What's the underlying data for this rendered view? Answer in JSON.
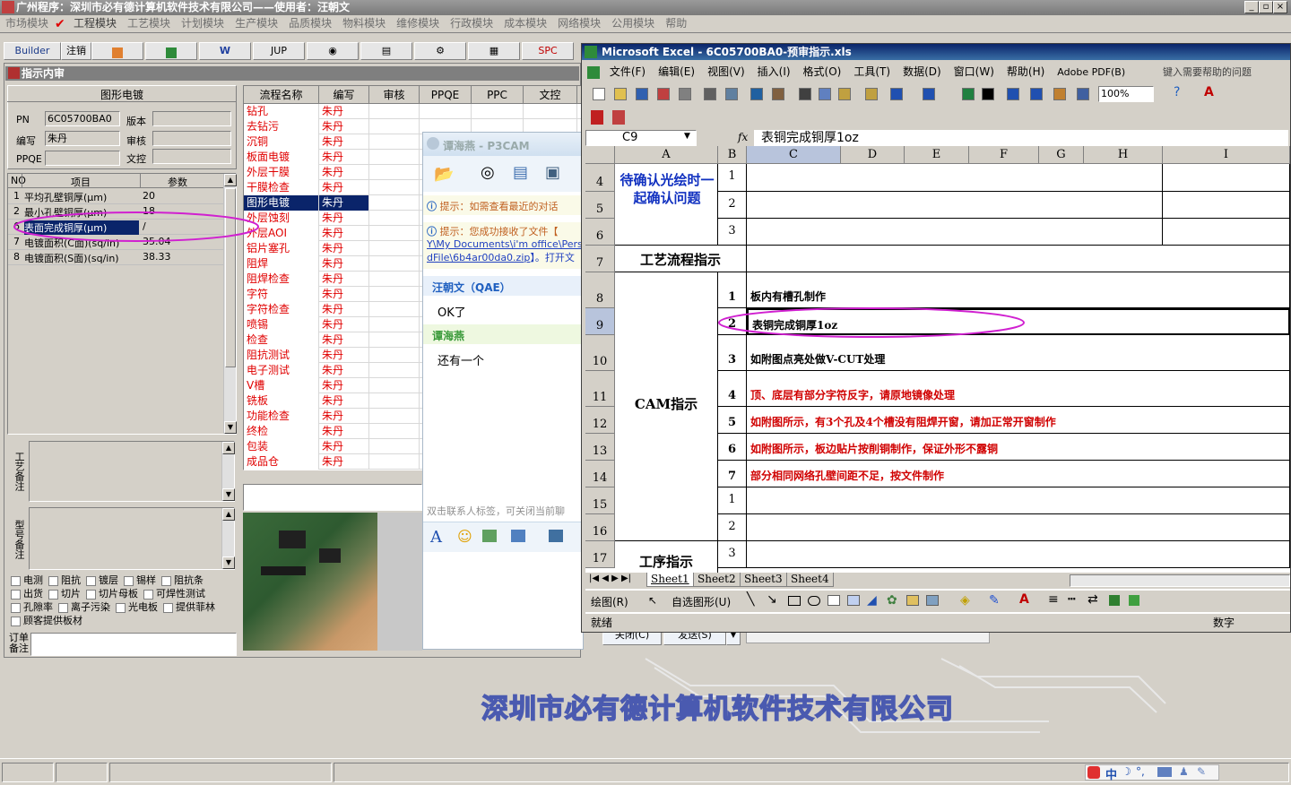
{
  "app": {
    "title": "广州程序：深圳市必有德计算机软件技术有限公司——使用者：汪朝文",
    "menu": [
      "市场模块",
      "工程模块",
      "工艺模块",
      "计划模块",
      "生产模块",
      "品质模块",
      "物料模块",
      "维修模块",
      "行政模块",
      "成本模块",
      "网络模块",
      "公用模块",
      "帮助"
    ],
    "toolbar": [
      "Builder",
      "注销",
      "",
      "",
      "W",
      "JUP",
      "",
      "",
      "",
      "",
      "SPC"
    ]
  },
  "left_panel": {
    "header": "指示内审",
    "section_title": "图形电镀",
    "fields": {
      "pn_label": "PN",
      "pn_value": "6C05700BA0",
      "version_label": "版本",
      "version_value": "",
      "writer_label": "编写",
      "writer_value": "朱丹",
      "audit_label": "审核",
      "audit_value": "",
      "ppqe_label": "PPQE",
      "ppqe_value": "",
      "doc_label": "文控",
      "doc_value": ""
    },
    "param_table": {
      "headers": [
        "NO",
        "项目",
        "参数"
      ],
      "rows": [
        [
          "1",
          "平均孔壁铜厚(μm)",
          "20"
        ],
        [
          "2",
          "最小孔壁铜厚(μm)",
          "18"
        ],
        [
          "6",
          "表面完成铜厚(μm)",
          "/"
        ],
        [
          "7",
          "电镀面积(C面)(sq/in)",
          "35.04"
        ],
        [
          "8",
          "电镀面积(S面)(sq/in)",
          "38.33"
        ]
      ]
    },
    "process_note_label": "工艺备注",
    "model_note_label": "型号备注",
    "order_note_label": "订单备注",
    "checkboxes": [
      [
        "电测",
        "阻抗",
        "镀层",
        "锡样",
        "阻抗条"
      ],
      [
        "出货",
        "切片",
        "切片母板",
        "可焊性测试"
      ],
      [
        "孔隙率",
        "离子污染",
        "光电板",
        "提供菲林"
      ],
      [
        "顾客提供板材"
      ]
    ]
  },
  "flow_table": {
    "headers": [
      "流程名称",
      "编写",
      "审核",
      "PPQE",
      "PPC",
      "文控"
    ],
    "rows": [
      [
        "钻孔",
        "朱丹"
      ],
      [
        "去钻污",
        "朱丹"
      ],
      [
        "沉铜",
        "朱丹"
      ],
      [
        "板面电镀",
        "朱丹"
      ],
      [
        "外层干膜",
        "朱丹"
      ],
      [
        "干膜检查",
        "朱丹"
      ],
      [
        "图形电镀",
        "朱丹"
      ],
      [
        "外层蚀刻",
        "朱丹"
      ],
      [
        "外层AOI",
        "朱丹"
      ],
      [
        "铝片塞孔",
        "朱丹"
      ],
      [
        "阻焊",
        "朱丹"
      ],
      [
        "阻焊检查",
        "朱丹"
      ],
      [
        "字符",
        "朱丹"
      ],
      [
        "字符检查",
        "朱丹"
      ],
      [
        "喷锡",
        "朱丹"
      ],
      [
        "检查",
        "朱丹"
      ],
      [
        "阻抗测试",
        "朱丹"
      ],
      [
        "电子测试",
        "朱丹"
      ],
      [
        "V槽",
        "朱丹"
      ],
      [
        "铣板",
        "朱丹"
      ],
      [
        "功能检查",
        "朱丹"
      ],
      [
        "终检",
        "朱丹"
      ],
      [
        "包装",
        "朱丹"
      ],
      [
        "成品仓",
        "朱丹"
      ]
    ],
    "selected_index": 6
  },
  "chat": {
    "title": "谭海燕 - P3CAM",
    "tip1": "提示：如需查看最近的对话",
    "tip2": "提示：您成功接收了文件【",
    "tip2_path": "Y\\My Documents\\i'm office\\Person",
    "tip2_file": "dFile\\6b4ar00da0.zip",
    "tip2_open": "】。打开文",
    "sender1": "汪朝文（QAE）",
    "msg1": "OK了",
    "sender2": "谭海燕",
    "msg2": "还有一个",
    "hint": "双击联系人标签，可关闭当前聊",
    "close_btn": "关闭(C)",
    "send_btn": "发送(S)"
  },
  "excel": {
    "title": "Microsoft Excel - 6C05700BA0-预审指示.xls",
    "menu": [
      "文件(F)",
      "编辑(E)",
      "视图(V)",
      "插入(I)",
      "格式(O)",
      "工具(T)",
      "数据(D)",
      "窗口(W)",
      "帮助(H)",
      "Adobe PDF(B)"
    ],
    "help_placeholder": "键入需要帮助的问题",
    "zoom": "100%",
    "name_box": "C9",
    "formula": "表铜完成铜厚1oz",
    "columns": [
      "A",
      "B",
      "C",
      "D",
      "E",
      "F",
      "G",
      "H",
      "I"
    ],
    "row_numbers": [
      "4",
      "5",
      "6",
      "7",
      "8",
      "9",
      "10",
      "11",
      "12",
      "13",
      "14",
      "15",
      "16",
      "17"
    ],
    "confirm_label": "待确认光绘时一起确认问题",
    "process_label": "工艺流程指示",
    "cam_label": "CAM指示",
    "step_label": "工序指示",
    "b_nums_top": [
      "1",
      "2",
      "3"
    ],
    "cam_items": [
      {
        "n": "1",
        "text": "板内有槽孔制作",
        "color": "#000000"
      },
      {
        "n": "2",
        "text": "表铜完成铜厚1oz",
        "color": "#000000"
      },
      {
        "n": "3",
        "text": "如附图点亮处做V-CUT处理",
        "color": "#000000"
      },
      {
        "n": "4",
        "text": "顶、底层有部分字符反字，请原地镜像处理",
        "color": "#d00000"
      },
      {
        "n": "5",
        "text": "如附图所示，有3个孔及4个槽没有阻焊开窗，请加正常开窗制作",
        "color": "#d00000"
      },
      {
        "n": "6",
        "text": "如附图所示，板边贴片按削铜制作，保证外形不露铜",
        "color": "#d00000"
      },
      {
        "n": "7",
        "text": "部分相同网络孔壁间距不足，按文件制作",
        "color": "#d00000"
      }
    ],
    "b_nums_bottom": [
      "1",
      "2",
      "3"
    ],
    "sheets": [
      "Sheet1",
      "Sheet2",
      "Sheet3",
      "Sheet4"
    ],
    "draw_label": "绘图(R)",
    "autoshape_label": "自选图形(U)",
    "status_ready": "就绪",
    "status_num": "数字"
  },
  "footer": {
    "company": "深圳市必有德计算机软件技术有限公司"
  },
  "colors": {
    "selection": "#0a246a",
    "red_text": "#e00000",
    "excel_title": "#0a246a",
    "highlight_ellipse": "#d020d0"
  }
}
